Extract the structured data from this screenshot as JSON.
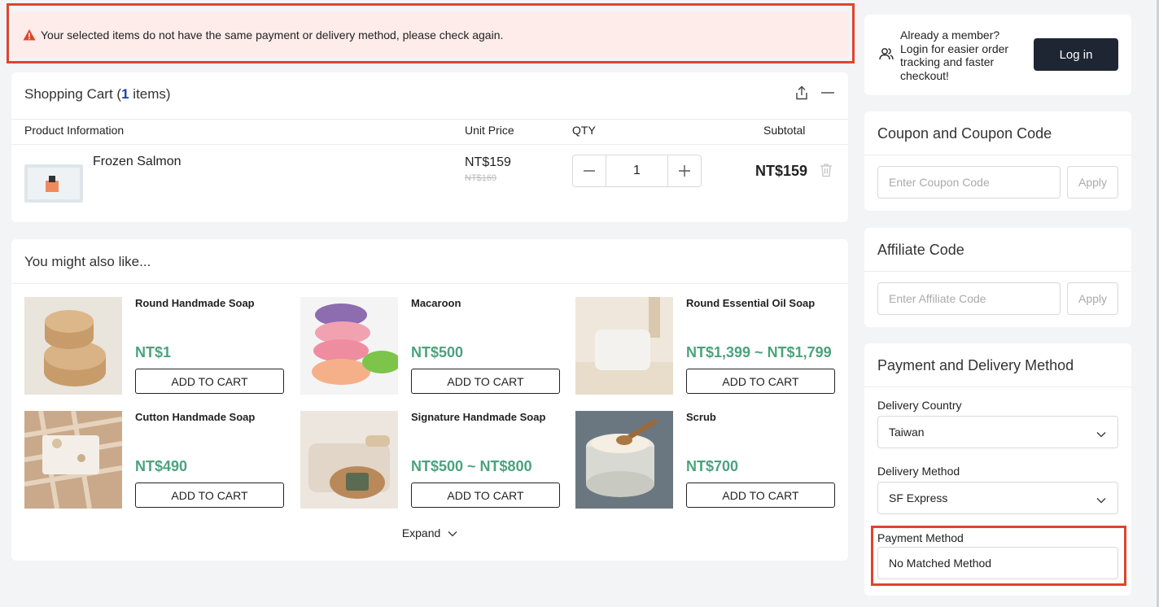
{
  "alert": {
    "message": "Your selected items do not have the same payment or delivery method, please check again."
  },
  "cart": {
    "title": "Shopping Cart",
    "count_open": "(",
    "count": "1",
    "count_suffix": "items)",
    "columns": {
      "product": "Product Information",
      "unit_price": "Unit Price",
      "qty": "QTY",
      "subtotal": "Subtotal"
    },
    "items": [
      {
        "name": "Frozen Salmon",
        "price": "NT$159",
        "original_price": "NT$169",
        "qty": "1",
        "subtotal": "NT$159"
      }
    ]
  },
  "recommendations": {
    "title": "You might also like...",
    "button_label": "ADD TO CART",
    "expand_label": "Expand",
    "items": [
      {
        "name": "Round Handmade Soap",
        "price": "NT$1"
      },
      {
        "name": "Macaroon",
        "price": "NT$500"
      },
      {
        "name": "Round Essential Oil Soap",
        "price": "NT$1,399 ~ NT$1,799"
      },
      {
        "name": "Cutton Handmade Soap",
        "price": "NT$490"
      },
      {
        "name": "Signature Handmade Soap",
        "price": "NT$500 ~ NT$800"
      },
      {
        "name": "Scrub",
        "price": "NT$700"
      }
    ]
  },
  "login": {
    "text": "Already a member? Login for easier order tracking and faster checkout!",
    "button": "Log in"
  },
  "coupon": {
    "title": "Coupon and Coupon Code",
    "placeholder": "Enter Coupon Code",
    "apply": "Apply"
  },
  "affiliate": {
    "title": "Affiliate Code",
    "placeholder": "Enter Affiliate Code",
    "apply": "Apply"
  },
  "payment_delivery": {
    "title": "Payment and Delivery Method",
    "country_label": "Delivery Country",
    "country_value": "Taiwan",
    "method_label": "Delivery Method",
    "method_value": "SF Express",
    "payment_label": "Payment Method",
    "payment_value": "No Matched Method"
  },
  "colors": {
    "alert_bg": "#fdecea",
    "highlight_border": "#e0442c",
    "price_green": "#4aa37d",
    "primary_dark": "#1f2633"
  }
}
